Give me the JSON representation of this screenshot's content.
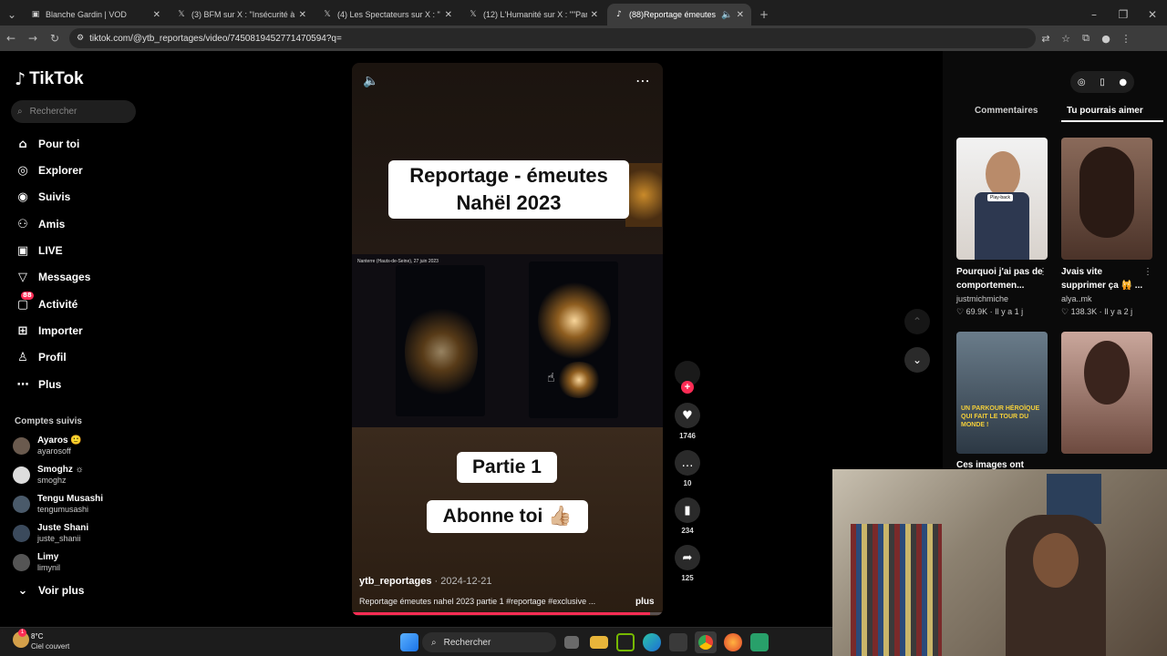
{
  "browser": {
    "tabs": [
      {
        "label": "Blanche Gardin | VOD",
        "icon": "page-icon"
      },
      {
        "label": "(3) BFM sur X : \"Insécurité à Ma",
        "icon": "x-icon"
      },
      {
        "label": "(4) Les Spectateurs sur X : \"",
        "icon": "x-icon"
      },
      {
        "label": "(12) L'Humanité sur X : \"\"Parler",
        "icon": "x-icon"
      },
      {
        "label": "(88)Reportage émeutes nah",
        "icon": "tiktok-icon"
      }
    ],
    "url": "tiktok.com/@ytb_reportages/video/7450819452771470594?q="
  },
  "tiktok": {
    "logo": "TikTok",
    "search_placeholder": "Rechercher",
    "nav": [
      {
        "label": "Pour toi",
        "icon": "home-icon"
      },
      {
        "label": "Explorer",
        "icon": "compass-icon"
      },
      {
        "label": "Suivis",
        "icon": "following-icon"
      },
      {
        "label": "Amis",
        "icon": "friends-icon"
      },
      {
        "label": "LIVE",
        "icon": "live-icon"
      },
      {
        "label": "Messages",
        "icon": "messages-icon"
      },
      {
        "label": "Activité",
        "icon": "activity-icon",
        "badge": "88"
      },
      {
        "label": "Importer",
        "icon": "upload-icon"
      },
      {
        "label": "Profil",
        "icon": "profile-icon"
      },
      {
        "label": "Plus",
        "icon": "more-icon"
      }
    ],
    "following_title": "Comptes suivis",
    "accounts": [
      {
        "name": "Ayaros 🙂",
        "handle": "ayarosoff"
      },
      {
        "name": "Smoghz ☼",
        "handle": "smoghz"
      },
      {
        "name": "Tengu Musashi",
        "handle": "tengumusashi"
      },
      {
        "name": "Juste Shani",
        "handle": "juste_shanii"
      },
      {
        "name": "Limy",
        "handle": "limynil"
      }
    ],
    "see_more": "Voir plus"
  },
  "video": {
    "caption_top": "Reportage - émeutes\nNahël 2023",
    "location": "Nanterre (Hauts-de-Seine), 27 juin 2023",
    "caption_part": "Partie 1",
    "caption_sub": "Abonne toi 👍🏼",
    "username": "ytb_reportages",
    "date": "· 2024-12-21",
    "description": "Reportage émeutes nahel 2023 partie 1 #reportage #exclusive ...",
    "more_label": "plus",
    "progress": 0.96
  },
  "actions": {
    "likes": "1746",
    "comments": "10",
    "saves": "234",
    "shares": "125"
  },
  "right_panel": {
    "tab_comments": "Commentaires",
    "tab_suggestions": "Tu pourrais aimer",
    "cards": [
      {
        "title": "Pourquoi j'ai pas de comportemen...",
        "author": "justmichmiche",
        "meta": "♡ 69.9K · Il y a 1 j",
        "thumb_label": "Play-back"
      },
      {
        "title": "Jvais vite supprimer ça 🙀 ...",
        "author": "alya..mk",
        "meta": "♡ 138.3K · Il y a 2 j",
        "thumb_label": ""
      },
      {
        "title": "Ces images ont",
        "author": "",
        "meta": "",
        "thumb_label": "UN PARKOUR HÉROÏQUE QUI FAIT LE TOUR DU MONDE !"
      },
      {
        "title": "",
        "author": "",
        "meta": "",
        "thumb_label": ""
      }
    ]
  },
  "taskbar": {
    "weather_temp": "8°C",
    "weather_desc": "Ciel couvert",
    "search": "Rechercher"
  },
  "colors": {
    "accent": "#fe2c55",
    "background": "#000000"
  }
}
